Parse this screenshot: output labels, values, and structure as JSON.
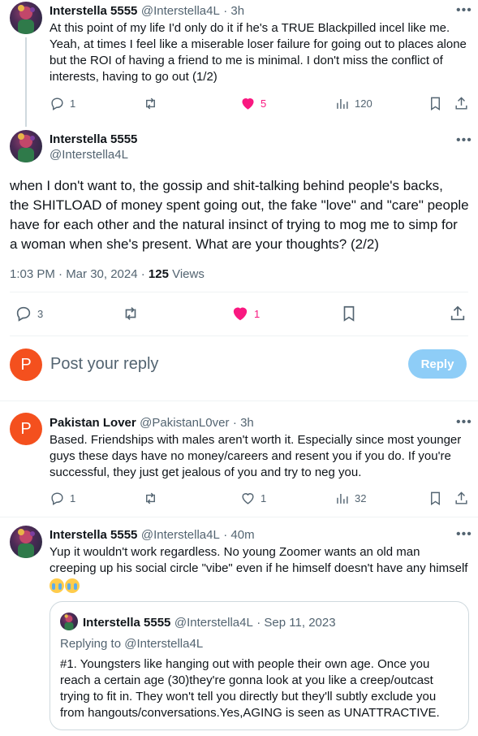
{
  "tweets": {
    "t1": {
      "name": "Interstella 5555",
      "handle": "@Interstella4L",
      "time": "· 3h",
      "lines": [
        "At this point of my life I'd only do it if he's a TRUE Blackpilled incel like me.",
        "Yeah, at times I feel like a miserable loser failure for going out to places alone",
        "but the ROI of having a friend to me is minimal. I don't miss the conflict of",
        "interests, having to go out (1/2)"
      ],
      "replies": "1",
      "likes": "5",
      "views": "120"
    },
    "main": {
      "name": "Interstella 5555",
      "handle": "@Interstella4L",
      "lines": [
        "when I don't want to, the gossip and shit-talking behind people's backs,",
        "the SHITLOAD of money spent going out, the fake \"love\" and \"care\" people",
        "have for each other and the natural insinct of trying to mog me to simp for",
        "a woman when she's present. What are your thoughts? (2/2)"
      ],
      "meta_time": "1:03 PM · Mar 30, 2024 · ",
      "views_count": "125",
      "views_label": " Views",
      "replies": "3",
      "likes": "1"
    },
    "compose": {
      "avatar_letter": "P",
      "placeholder": "Post your reply",
      "button": "Reply"
    },
    "t3": {
      "avatar_letter": "P",
      "name": "Pakistan Lover",
      "handle": "@PakistanL0ver",
      "time": "· 3h",
      "lines": [
        "Based. Friendships with males aren't worth it. Especially since most younger",
        "guys these days have no money/careers and resent you if you do. If you're",
        "successful, they just get jealous of you and try to neg you."
      ],
      "replies": "1",
      "likes": "1",
      "views": "32"
    },
    "t4": {
      "name": "Interstella 5555",
      "handle": "@Interstella4L",
      "time": "· 40m",
      "lines": [
        "Yup it wouldn't work regardless. No young Zoomer wants an old man",
        "creeping up his social circle \"vibe\" even if he himself doesn't have any himself"
      ],
      "quote": {
        "name": "Interstella 5555",
        "handle": "@Interstella4L",
        "time": "· Sep 11, 2023",
        "replying": "Replying to @Interstella4L",
        "lines": [
          "#1. Youngsters like hanging out with people their own age. Once you",
          "reach a certain age (30)they're gonna look at you like a creep/outcast",
          "trying to fit in. They won't tell you directly but they'll subtly exclude you",
          "from hangouts/conversations.Yes,AGING is seen as UNATTRACTIVE."
        ]
      }
    }
  },
  "colors": {
    "like_pink": "#f91880",
    "reply_button": "#8ecdf7",
    "avatar_orange": "#f4501e",
    "secondary_text": "#536471"
  },
  "icons": [
    "more-icon",
    "reply-icon",
    "retweet-icon",
    "heart-icon",
    "views-icon",
    "bookmark-icon",
    "share-icon",
    "crying-emoji-icon"
  ]
}
